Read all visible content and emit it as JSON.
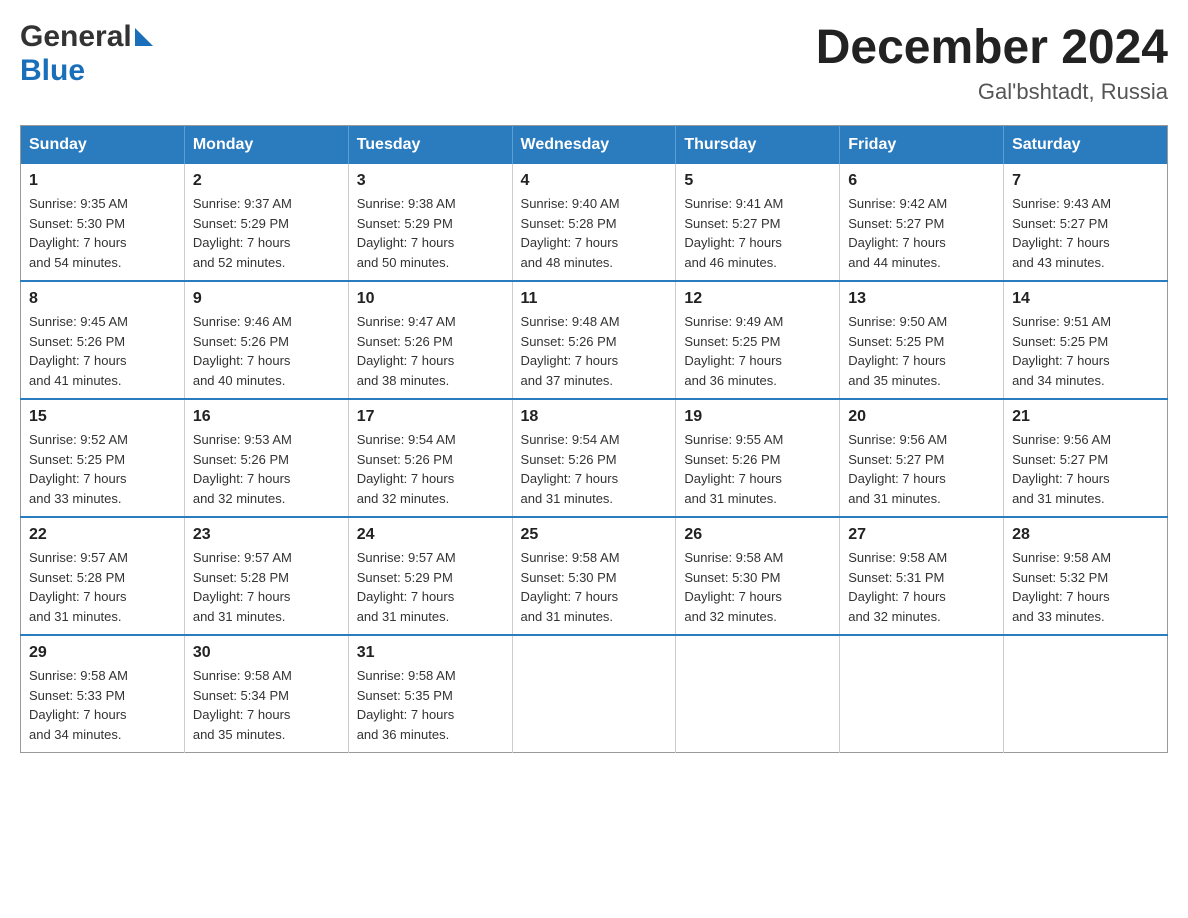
{
  "header": {
    "logo_general": "General",
    "logo_blue": "Blue",
    "title": "December 2024",
    "subtitle": "Gal'bshtadt, Russia"
  },
  "days_of_week": [
    "Sunday",
    "Monday",
    "Tuesday",
    "Wednesday",
    "Thursday",
    "Friday",
    "Saturday"
  ],
  "weeks": [
    [
      {
        "day": "1",
        "sunrise": "9:35 AM",
        "sunset": "5:30 PM",
        "daylight_hours": "7 hours",
        "daylight_minutes": "and 54 minutes."
      },
      {
        "day": "2",
        "sunrise": "9:37 AM",
        "sunset": "5:29 PM",
        "daylight_hours": "7 hours",
        "daylight_minutes": "and 52 minutes."
      },
      {
        "day": "3",
        "sunrise": "9:38 AM",
        "sunset": "5:29 PM",
        "daylight_hours": "7 hours",
        "daylight_minutes": "and 50 minutes."
      },
      {
        "day": "4",
        "sunrise": "9:40 AM",
        "sunset": "5:28 PM",
        "daylight_hours": "7 hours",
        "daylight_minutes": "and 48 minutes."
      },
      {
        "day": "5",
        "sunrise": "9:41 AM",
        "sunset": "5:27 PM",
        "daylight_hours": "7 hours",
        "daylight_minutes": "and 46 minutes."
      },
      {
        "day": "6",
        "sunrise": "9:42 AM",
        "sunset": "5:27 PM",
        "daylight_hours": "7 hours",
        "daylight_minutes": "and 44 minutes."
      },
      {
        "day": "7",
        "sunrise": "9:43 AM",
        "sunset": "5:27 PM",
        "daylight_hours": "7 hours",
        "daylight_minutes": "and 43 minutes."
      }
    ],
    [
      {
        "day": "8",
        "sunrise": "9:45 AM",
        "sunset": "5:26 PM",
        "daylight_hours": "7 hours",
        "daylight_minutes": "and 41 minutes."
      },
      {
        "day": "9",
        "sunrise": "9:46 AM",
        "sunset": "5:26 PM",
        "daylight_hours": "7 hours",
        "daylight_minutes": "and 40 minutes."
      },
      {
        "day": "10",
        "sunrise": "9:47 AM",
        "sunset": "5:26 PM",
        "daylight_hours": "7 hours",
        "daylight_minutes": "and 38 minutes."
      },
      {
        "day": "11",
        "sunrise": "9:48 AM",
        "sunset": "5:26 PM",
        "daylight_hours": "7 hours",
        "daylight_minutes": "and 37 minutes."
      },
      {
        "day": "12",
        "sunrise": "9:49 AM",
        "sunset": "5:25 PM",
        "daylight_hours": "7 hours",
        "daylight_minutes": "and 36 minutes."
      },
      {
        "day": "13",
        "sunrise": "9:50 AM",
        "sunset": "5:25 PM",
        "daylight_hours": "7 hours",
        "daylight_minutes": "and 35 minutes."
      },
      {
        "day": "14",
        "sunrise": "9:51 AM",
        "sunset": "5:25 PM",
        "daylight_hours": "7 hours",
        "daylight_minutes": "and 34 minutes."
      }
    ],
    [
      {
        "day": "15",
        "sunrise": "9:52 AM",
        "sunset": "5:25 PM",
        "daylight_hours": "7 hours",
        "daylight_minutes": "and 33 minutes."
      },
      {
        "day": "16",
        "sunrise": "9:53 AM",
        "sunset": "5:26 PM",
        "daylight_hours": "7 hours",
        "daylight_minutes": "and 32 minutes."
      },
      {
        "day": "17",
        "sunrise": "9:54 AM",
        "sunset": "5:26 PM",
        "daylight_hours": "7 hours",
        "daylight_minutes": "and 32 minutes."
      },
      {
        "day": "18",
        "sunrise": "9:54 AM",
        "sunset": "5:26 PM",
        "daylight_hours": "7 hours",
        "daylight_minutes": "and 31 minutes."
      },
      {
        "day": "19",
        "sunrise": "9:55 AM",
        "sunset": "5:26 PM",
        "daylight_hours": "7 hours",
        "daylight_minutes": "and 31 minutes."
      },
      {
        "day": "20",
        "sunrise": "9:56 AM",
        "sunset": "5:27 PM",
        "daylight_hours": "7 hours",
        "daylight_minutes": "and 31 minutes."
      },
      {
        "day": "21",
        "sunrise": "9:56 AM",
        "sunset": "5:27 PM",
        "daylight_hours": "7 hours",
        "daylight_minutes": "and 31 minutes."
      }
    ],
    [
      {
        "day": "22",
        "sunrise": "9:57 AM",
        "sunset": "5:28 PM",
        "daylight_hours": "7 hours",
        "daylight_minutes": "and 31 minutes."
      },
      {
        "day": "23",
        "sunrise": "9:57 AM",
        "sunset": "5:28 PM",
        "daylight_hours": "7 hours",
        "daylight_minutes": "and 31 minutes."
      },
      {
        "day": "24",
        "sunrise": "9:57 AM",
        "sunset": "5:29 PM",
        "daylight_hours": "7 hours",
        "daylight_minutes": "and 31 minutes."
      },
      {
        "day": "25",
        "sunrise": "9:58 AM",
        "sunset": "5:30 PM",
        "daylight_hours": "7 hours",
        "daylight_minutes": "and 31 minutes."
      },
      {
        "day": "26",
        "sunrise": "9:58 AM",
        "sunset": "5:30 PM",
        "daylight_hours": "7 hours",
        "daylight_minutes": "and 32 minutes."
      },
      {
        "day": "27",
        "sunrise": "9:58 AM",
        "sunset": "5:31 PM",
        "daylight_hours": "7 hours",
        "daylight_minutes": "and 32 minutes."
      },
      {
        "day": "28",
        "sunrise": "9:58 AM",
        "sunset": "5:32 PM",
        "daylight_hours": "7 hours",
        "daylight_minutes": "and 33 minutes."
      }
    ],
    [
      {
        "day": "29",
        "sunrise": "9:58 AM",
        "sunset": "5:33 PM",
        "daylight_hours": "7 hours",
        "daylight_minutes": "and 34 minutes."
      },
      {
        "day": "30",
        "sunrise": "9:58 AM",
        "sunset": "5:34 PM",
        "daylight_hours": "7 hours",
        "daylight_minutes": "and 35 minutes."
      },
      {
        "day": "31",
        "sunrise": "9:58 AM",
        "sunset": "5:35 PM",
        "daylight_hours": "7 hours",
        "daylight_minutes": "and 36 minutes."
      },
      null,
      null,
      null,
      null
    ]
  ]
}
